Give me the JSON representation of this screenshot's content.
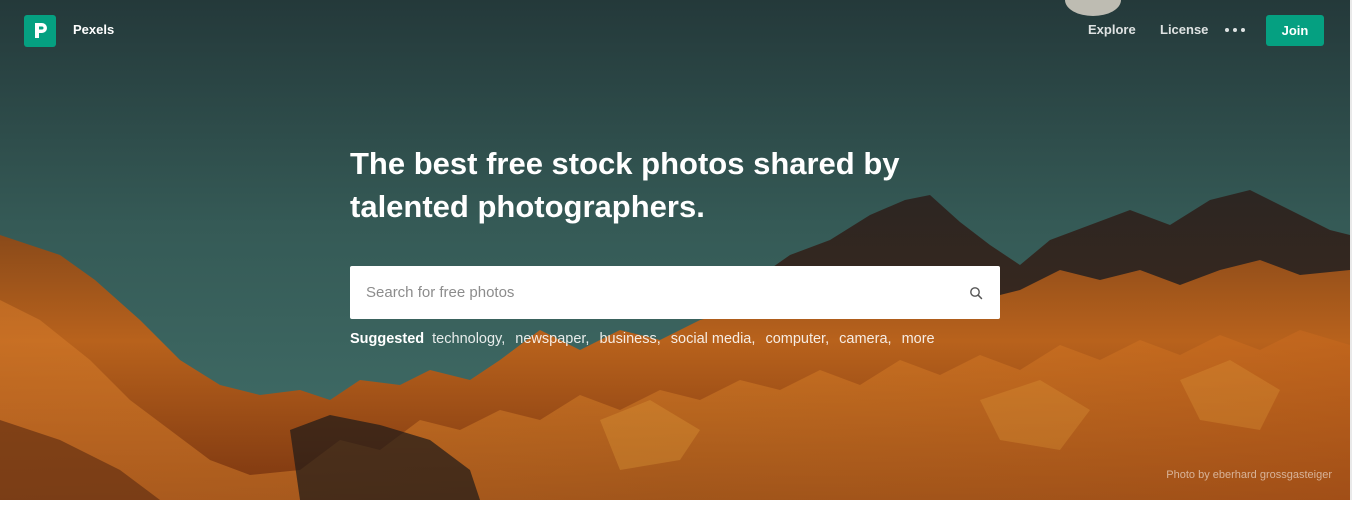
{
  "header": {
    "brand": "Pexels",
    "nav": {
      "explore": "Explore",
      "license": "License",
      "join": "Join"
    }
  },
  "hero": {
    "headline_line1": "The best free stock photos shared by",
    "headline_line2": "talented photographers.",
    "search": {
      "placeholder": "Search for free photos"
    },
    "suggested": {
      "label": "Suggested",
      "tags": [
        "technology",
        "newspaper",
        "business",
        "social media",
        "computer",
        "camera",
        "more"
      ]
    },
    "credit": "Photo by eberhard grossgasteiger"
  },
  "colors": {
    "brand_green": "#05a081",
    "sky_teal": "#3b6460",
    "mountain_orange": "#c56a1c"
  },
  "icons": [
    "pexels-logo-icon",
    "more-dots-icon",
    "search-icon"
  ]
}
